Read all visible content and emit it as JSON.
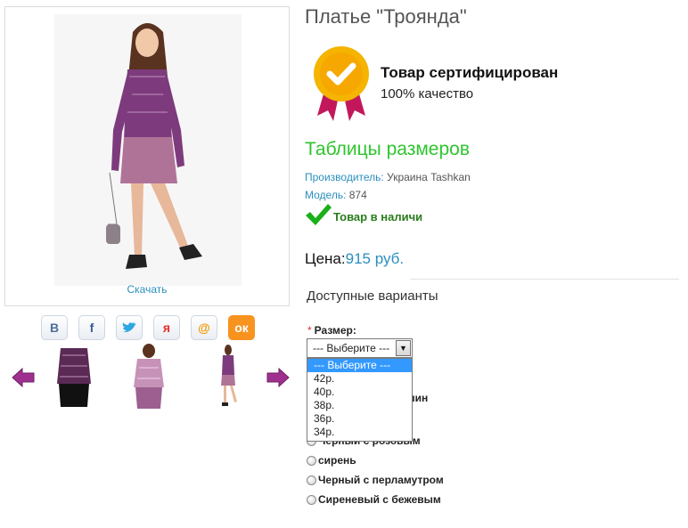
{
  "product": {
    "title": "Платье \"Троянда\"",
    "download_label": "Скачать"
  },
  "certificate": {
    "title": "Товар сертифицирован",
    "subtitle": "100% качество"
  },
  "size_table_label": "Таблицы размеров",
  "manufacturer": {
    "label": "Производитель:",
    "value": "Украина Tashkan"
  },
  "model": {
    "label": "Модель:",
    "value": "874"
  },
  "stock_label": "Товар в наличи",
  "price": {
    "label": "Цена:",
    "value": "915 руб."
  },
  "options_title": "Доступные варианты",
  "size": {
    "label": "Размер:",
    "required_mark": "*",
    "selected": "--- Выберите ---",
    "options": [
      "--- Выберите ---",
      "42р.",
      "40р.",
      "38р.",
      "36р.",
      "34р."
    ]
  },
  "colors": {
    "partial_visible": "лин",
    "options": [
      "Черный с розовым",
      "сирень",
      "Черный с перламутром",
      "Сиреневый с бежевым"
    ]
  },
  "share_icons": [
    "vk-icon",
    "facebook-icon",
    "twitter-icon",
    "ya-icon",
    "mail-icon",
    "odnoklassniki-icon"
  ],
  "colors_palette": {
    "accent_blue": "#2a8fbd",
    "accent_green": "#2ec62e",
    "stock_green": "#2a7d1c",
    "dress_purple": "#8b4a8b"
  }
}
